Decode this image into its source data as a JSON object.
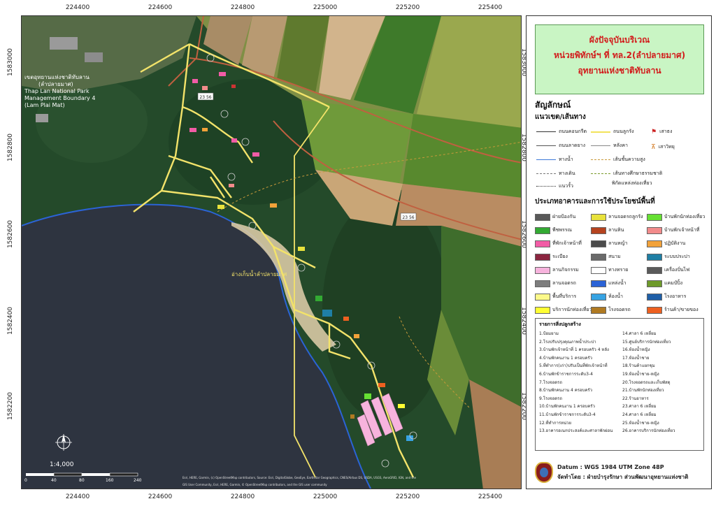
{
  "title": {
    "line1": "ผังปัจจุบันบริเวณ",
    "line2": "หน่วยพิทักษ์ฯ ที่ ทล.2(ลำปลายมาศ)",
    "line3": "อุทยานแห่งชาติทับลาน"
  },
  "ticks": {
    "x": [
      "224400",
      "224600",
      "224800",
      "225000",
      "225200",
      "225400"
    ],
    "y": [
      "1583000",
      "1582800",
      "1582600",
      "1582400",
      "1582200"
    ]
  },
  "map_labels": {
    "park_boundary_th": "เขตอุทยานแห่งชาติทับลาน",
    "park_boundary_th2": "(ลำปลายมาศ)",
    "park_boundary_en1": "Thap Lan National Park",
    "park_boundary_en2": "Management Boundary 4",
    "park_boundary_en3": "(Lam Plai Mat)",
    "road_label_1": "23 56",
    "road_label_2": "23 56",
    "reservoir": "อ่างเก็บน้ำลำปลายมาศ",
    "scale": "1:4,000",
    "scale_ticks": [
      "0",
      "40",
      "80",
      "160",
      "240"
    ],
    "attribution1": "Esri, HERE, Garmin, (c) OpenStreetMap contributors, Source: Esri, DigitalGlobe, GeoEye, Earthstar Geographics, CNES/Airbus DS, USDA, USGS, AeroGRID, IGN, and the",
    "attribution2": "GIS User Community, Esri, HERE, Garmin, © OpenStreetMap contributors, and the GIS user community"
  },
  "legend": {
    "symbols_title": "สัญลักษณ์",
    "lines_title": "แนวเขต/เส้นทาง",
    "lines": [
      {
        "label": "ถนนคอนกรีต",
        "color": "#333333"
      },
      {
        "label": "ถนนลาดยาง",
        "color": "#555555"
      },
      {
        "label": "ทางน้ำ",
        "color": "#3c78d8"
      },
      {
        "label": "ทางเดิน",
        "color": "#777777"
      },
      {
        "label": "แนวรั้ว",
        "color": "#333333"
      },
      {
        "label": "ถนนลูกรัง",
        "color": "#f2e35a"
      },
      {
        "label": "หลังคา",
        "color": "#888888"
      },
      {
        "label": "เส้นชั้นความสูง",
        "color": "#c89a3a"
      },
      {
        "label": "เส้นทางศึกษาธรรมชาติ",
        "color": "#7a9a2a"
      },
      {
        "label": "พิกัดแหล่งท่องเที่ยว",
        "color": "#ffffff"
      }
    ],
    "points": [
      {
        "label": "เสาธง",
        "color": "#cc2222"
      },
      {
        "label": "เสาวิทยุ",
        "color": "#cc6600"
      }
    ],
    "landuse_title": "ประเภทอาคารและการใช้ประโยชน์พื้นที่",
    "landuse": [
      {
        "label": "ฝ่ายป้องกัน",
        "color": "#595959"
      },
      {
        "label": "พืชพรรณ",
        "color": "#33aa33"
      },
      {
        "label": "ที่พักเจ้าหน้าที่",
        "color": "#f25ca6"
      },
      {
        "label": "ระเบียง",
        "color": "#8b2540"
      },
      {
        "label": "ลานกิจกรรม",
        "color": "#f7b3dd"
      },
      {
        "label": "ลานจอดรถ",
        "color": "#7d7d7d"
      },
      {
        "label": "พื้นที่บริการ",
        "color": "#fcf98a"
      },
      {
        "label": "บริการนักท่องเที่ยว",
        "color": "#ffff33"
      },
      {
        "label": "ลานจอดรถลูกรัง",
        "color": "#e8e23c"
      },
      {
        "label": "ลานหิน",
        "color": "#b5431f"
      },
      {
        "label": "ลานหญ้า",
        "color": "#4b4b4b"
      },
      {
        "label": "สนาม",
        "color": "#6a6a6a"
      },
      {
        "label": "ทางทราย",
        "color": "#ffffff"
      },
      {
        "label": "แหล่งน้ำ",
        "color": "#2b63d6"
      },
      {
        "label": "ห้องน้ำ",
        "color": "#37a3e3"
      },
      {
        "label": "โรงจอดรถ",
        "color": "#b07a22"
      },
      {
        "label": "บ้านพักนักท่องเที่ยว",
        "color": "#66e033"
      },
      {
        "label": "บ้านพักเจ้าหน้าที่",
        "color": "#f28b8b"
      },
      {
        "label": "ปฏิบัติงาน",
        "color": "#f2a23a"
      },
      {
        "label": "ระบบประปา",
        "color": "#1f7fa5"
      },
      {
        "label": "เครื่องปั่นไฟ",
        "color": "#5a5a5a"
      },
      {
        "label": "แคมป์ปิ้ง",
        "color": "#6e9a2a"
      },
      {
        "label": "โรงอาหาร",
        "color": "#1f5fa8"
      },
      {
        "label": "ร้านค้า/ขายของ",
        "color": "#ee6020"
      }
    ],
    "buildings_title": "รายการสิ่งปลูกสร้าง",
    "buildings_col1": [
      "1.ป้อมยาม",
      "2.โรงปรับปรุงคุณภาพน้ำประปา",
      "3.บ้านพักเจ้าหน้าที่ 1 ครอบครัว 4 หลัง",
      "4.บ้านพักคนงาน 1 ครอบครัว",
      "5.ที่ทำการ(เก่า)ปรับเป็นที่พักเจ้าหน้าที่",
      "6.บ้านพักข้าราชการระดับ3-4",
      "7.โรงจอดรถ",
      "8.บ้านพักคนงาน 4 ครอบครัว",
      "9.โรงจอดรถ",
      "10.บ้านพักคนงาน 1 ครอบครัว",
      "11.บ้านพักข้าราชการระดับ3-4",
      "12.ที่ทำการหน่วย",
      "13.อาคารอเนกประสงค์และศาลาพักผ่อน"
    ],
    "buildings_col2": [
      "14.ศาลา 6 เหลี่ยม",
      "15.ศูนย์บริการนักท่องเที่ยว",
      "16.ห้องน้ำหญิง",
      "17.ห้องน้ำชาย",
      "18.ร้านค้าแยกชุม",
      "19.ห้องน้ำชาย-หญิง",
      "20.โรงจอดรถและเก็บพัสดุ",
      "21.บ้านพักนักท่องเที่ยว",
      "22.ร้านอาหาร",
      "23.ศาลา 6 เหลี่ยม",
      "24.ศาลา 6 เหลี่ยม",
      "25.ห้องน้ำชาย-หญิง",
      "26.อาคารบริการนักท่องเที่ยว"
    ]
  },
  "footer": {
    "datum": "Datum : WGS 1984 UTM Zone 48P",
    "producer": "จัดทำโดย : ฝ่ายบำรุงรักษา ส่วนพัฒนาอุทยานแห่งชาติ"
  },
  "colors": {
    "forest": "#244a2a",
    "water": "#2e3440",
    "field": "#8c9a4a",
    "road": "#f3e36a",
    "title_bg": "#c9f5c4",
    "title_text": "#d21b1b"
  }
}
